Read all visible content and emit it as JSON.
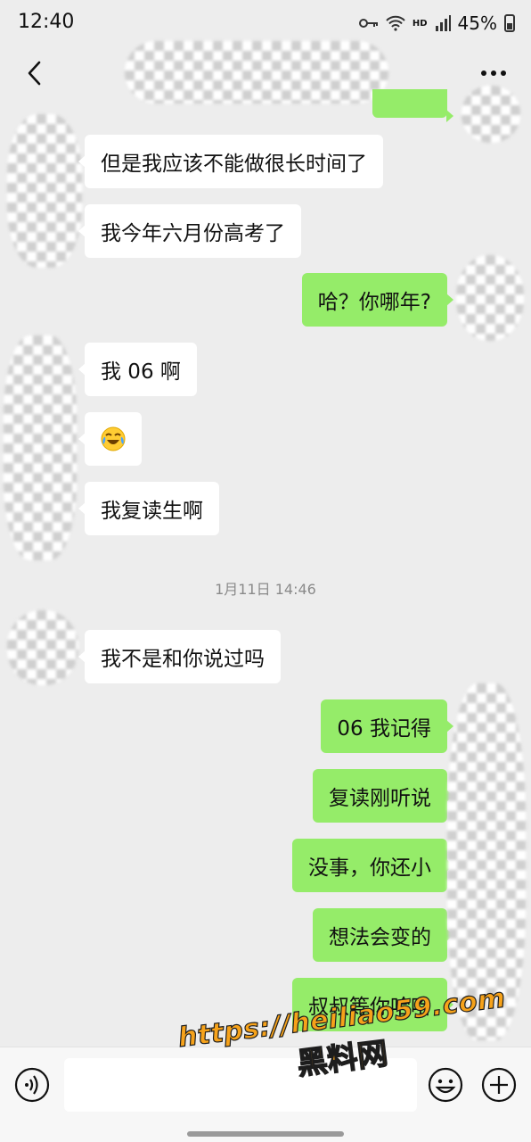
{
  "status_bar": {
    "time": "12:40",
    "hd_label": "HD",
    "battery": "45%"
  },
  "nav": {
    "back_icon": "chevron-left-icon",
    "more_icon": "more-dots-icon"
  },
  "messages": [
    {
      "dir": "out",
      "text": ""
    },
    {
      "dir": "in",
      "text": "但是我应该不能做很长时间了"
    },
    {
      "dir": "in",
      "text": "我今年六月份高考了"
    },
    {
      "dir": "out",
      "text": "哈？你哪年?"
    },
    {
      "dir": "in",
      "text": "我 06 啊"
    },
    {
      "dir": "in",
      "emoji": "crying-laughing-emoji"
    },
    {
      "dir": "in",
      "text": "我复读生啊"
    },
    {
      "dir": "in",
      "text": "我不是和你说过吗"
    },
    {
      "dir": "out",
      "text": "06 我记得"
    },
    {
      "dir": "out",
      "text": "复读刚听说"
    },
    {
      "dir": "out",
      "text": "没事，你还小"
    },
    {
      "dir": "out",
      "text": "想法会变的"
    },
    {
      "dir": "out",
      "text": "叔叔等你哈哈"
    }
  ],
  "timestamp": "1月11日 14:46",
  "input_bar": {
    "voice_icon": "voice-icon",
    "emoji_icon": "emoji-icon",
    "plus_icon": "plus-icon"
  },
  "watermark": {
    "url": "https://heiliao59.com",
    "name": "黑料网"
  },
  "colors": {
    "background": "#ededed",
    "incoming_bubble": "#ffffff",
    "outgoing_bubble": "#95ec69",
    "watermark": "#f6a21a"
  }
}
